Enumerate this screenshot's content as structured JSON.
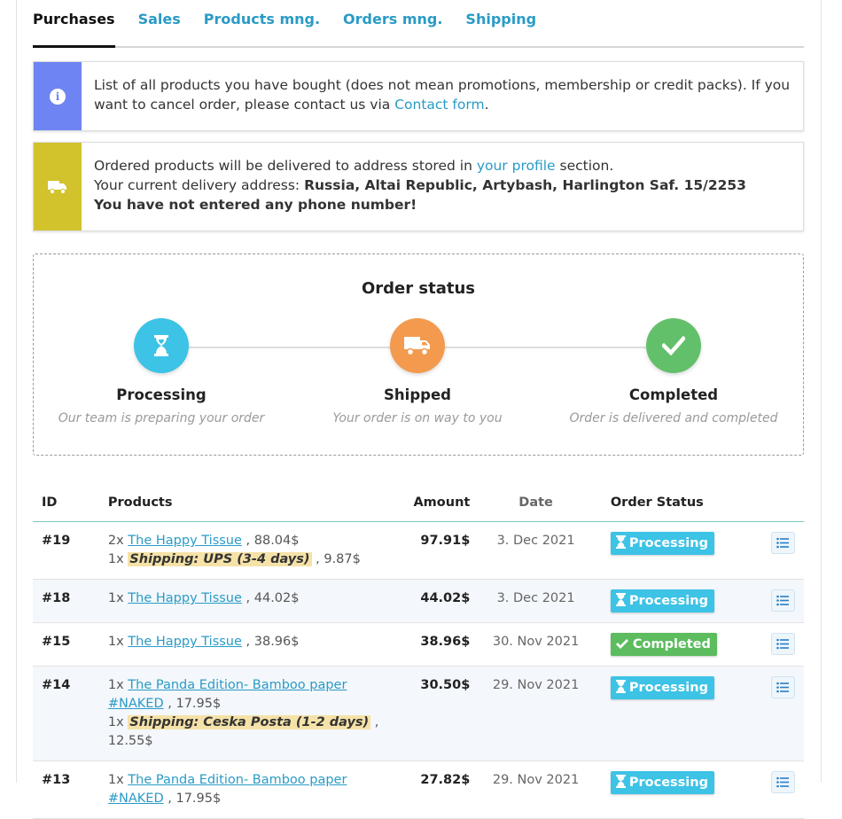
{
  "tabs": [
    "Purchases",
    "Sales",
    "Products mng.",
    "Orders mng.",
    "Shipping"
  ],
  "info_box": {
    "text_before": "List of all products you have bought (does not mean promotions, membership or credit packs). If you want to cancel order, please contact us via ",
    "link": "Contact form",
    "text_after": "."
  },
  "delivery_box": {
    "line1_before": "Ordered products will be delivered to address stored in ",
    "line1_link": "your profile",
    "line1_after": " section.",
    "line2_label": "Your current delivery address: ",
    "address": "Russia, Altai Republic, Artybash, Harlington Saf. 15/2253",
    "warning": "You have not entered any phone number!"
  },
  "order_status": {
    "title": "Order status",
    "steps": [
      {
        "name": "Processing",
        "desc": "Our team is preparing your order",
        "color": "#3cc3e6",
        "icon": "hourglass-icon"
      },
      {
        "name": "Shipped",
        "desc": "Your order is on way to you",
        "color": "#f39a4f",
        "icon": "truck-icon"
      },
      {
        "name": "Completed",
        "desc": "Order is delivered and completed",
        "color": "#63c06a",
        "icon": "check-icon"
      }
    ]
  },
  "table": {
    "headers": {
      "id": "ID",
      "products": "Products",
      "amount": "Amount",
      "date": "Date",
      "status": "Order Status"
    },
    "rows": [
      {
        "id": "#19",
        "amount": "97.91$",
        "date": "3. Dec 2021",
        "status": "Processing",
        "items": [
          {
            "qty": "2x",
            "name": "The Happy Tissue",
            "price": ", 88.04$"
          },
          {
            "qty": "1x",
            "shipping": "Shipping: UPS (3-4 days)",
            "price": ", 9.87$"
          }
        ]
      },
      {
        "id": "#18",
        "amount": "44.02$",
        "date": "3. Dec 2021",
        "status": "Processing",
        "items": [
          {
            "qty": "1x",
            "name": "The Happy Tissue",
            "price": ", 44.02$"
          }
        ]
      },
      {
        "id": "#15",
        "amount": "38.96$",
        "date": "30. Nov 2021",
        "status": "Completed",
        "items": [
          {
            "qty": "1x",
            "name": "The Happy Tissue",
            "price": ", 38.96$"
          }
        ]
      },
      {
        "id": "#14",
        "amount": "30.50$",
        "date": "29. Nov 2021",
        "status": "Processing",
        "items": [
          {
            "qty": "1x",
            "name": "The Panda Edition- Bamboo paper #NAKED",
            "price": ", 17.95$"
          },
          {
            "qty": "1x",
            "shipping": "Shipping: Ceska Posta (1-2 days)",
            "price": ", 12.55$"
          }
        ]
      },
      {
        "id": "#13",
        "amount": "27.82$",
        "date": "29. Nov 2021",
        "status": "Processing",
        "items": [
          {
            "qty": "1x",
            "name": "The Panda Edition- Bamboo paper #NAKED",
            "price": ", 17.95$"
          }
        ]
      }
    ]
  }
}
